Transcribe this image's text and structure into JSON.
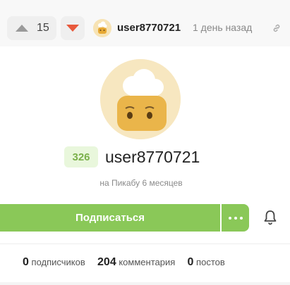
{
  "post_header": {
    "vote_count": "15",
    "username": "user8770721",
    "time": "1 день назад",
    "icons": {
      "upvote": "triangle-up-icon",
      "downvote": "triangle-down-icon",
      "link": "link-icon"
    },
    "colors": {
      "downvote": "#e8593c",
      "upvote": "#9a9a9a"
    }
  },
  "profile": {
    "rating": "326",
    "name": "user8770721",
    "member_since": "на Пикабу 6 месяцев",
    "colors": {
      "rating_bg": "#e9f7dc",
      "rating_text": "#7ab04a",
      "accent": "#8ac858"
    }
  },
  "actions": {
    "subscribe_label": "Подписаться",
    "more_icon": "more-dots-icon",
    "bell_icon": "bell-icon"
  },
  "stats": {
    "subscribers_count": "0",
    "subscribers_label": "подписчиков",
    "comments_count": "204",
    "comments_label": "комментария",
    "posts_count": "0",
    "posts_label": "постов"
  }
}
